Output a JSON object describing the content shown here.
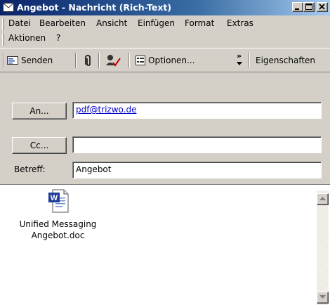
{
  "window": {
    "title": "Angebot - Nachricht (Rich-Text)",
    "colors": {
      "titlebar": "#0a246a",
      "face": "#d4d0c8",
      "link": "#0000cc"
    }
  },
  "title_buttons": {
    "minimize": "minimize-icon",
    "maximize": "maximize-icon",
    "close": "close-icon"
  },
  "menu": [
    {
      "label": "Datei"
    },
    {
      "label": "Bearbeiten"
    },
    {
      "label": "Ansicht"
    },
    {
      "label": "Einfügen"
    },
    {
      "label": "Format"
    },
    {
      "label": "Extras"
    },
    {
      "label": "Aktionen"
    },
    {
      "label": "?"
    }
  ],
  "toolbar": {
    "send_label": "Senden",
    "options_label": "Optionen...",
    "overflow_label": "»",
    "properties_label": "Eigenschaften"
  },
  "header": {
    "to_button": "An...",
    "to_value": "pdf@trizwo.de",
    "cc_button": "Cc...",
    "cc_value": "",
    "subject_label": "Betreff:",
    "subject_value": "Angebot"
  },
  "attachment": {
    "line1": "Unified Messaging",
    "line2": "Angebot.doc",
    "icon": "word-document-icon"
  }
}
